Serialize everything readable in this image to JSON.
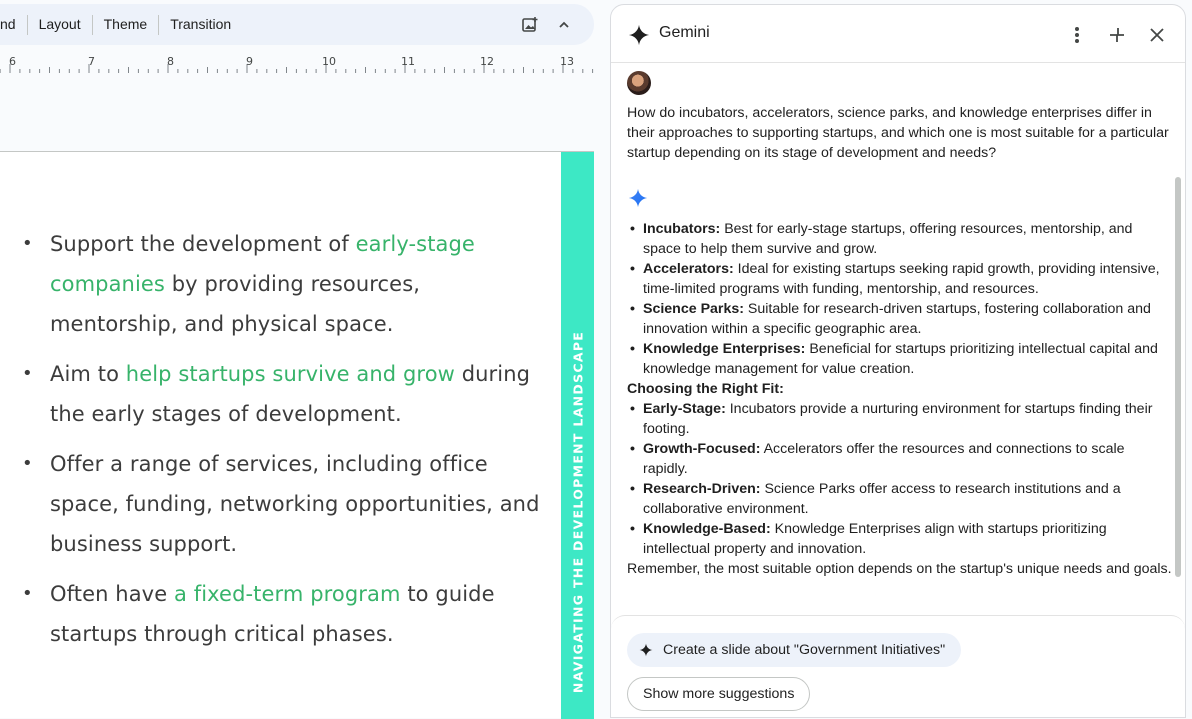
{
  "toolbar": {
    "items": [
      "nd",
      "Layout",
      "Theme",
      "Transition"
    ],
    "icons": [
      "insert-image-icon",
      "chevron-up-icon"
    ]
  },
  "ruler": {
    "labels": [
      "6",
      "7",
      "8",
      "9",
      "10",
      "11",
      "12",
      "13"
    ]
  },
  "slide": {
    "side_title": "NAVIGATING THE DEVELOPMENT LANDSCAPE",
    "accent_color": "#3de8c5",
    "highlight_color": "#37b36a",
    "bullets": [
      {
        "pre": "Support the development of ",
        "hl": "early-stage companies",
        "post": " by providing resources, mentorship, and physical space."
      },
      {
        "pre": "Aim to ",
        "hl": "help startups survive and grow",
        "post": " during the early stages of development."
      },
      {
        "pre": "Offer a range of services, including office space, funding, networking opportunities, and business support.",
        "hl": "",
        "post": ""
      },
      {
        "pre": "Often have ",
        "hl": "a fixed-term program",
        "post": " to guide startups through critical phases."
      }
    ]
  },
  "gemini": {
    "title": "Gemini",
    "question": "How do incubators, accelerators, science parks, and knowledge enterprises differ in their approaches to supporting startups, and which one is most suitable for a particular startup depending on its stage of development and needs?",
    "list1": [
      {
        "term": "Incubators:",
        "text": " Best for early-stage startups, offering resources, mentorship, and space to help them survive and grow."
      },
      {
        "term": "Accelerators:",
        "text": " Ideal for existing startups seeking rapid growth, providing intensive, time-limited programs with funding, mentorship, and resources."
      },
      {
        "term": "Science Parks:",
        "text": " Suitable for research-driven startups, fostering collaboration and innovation within a specific geographic area."
      },
      {
        "term": "Knowledge Enterprises:",
        "text": " Beneficial for startups prioritizing intellectual capital and knowledge management for value creation."
      }
    ],
    "heading2": "Choosing the Right Fit:",
    "list2": [
      {
        "term": "Early-Stage:",
        "text": " Incubators provide a nurturing environment for startups finding their footing."
      },
      {
        "term": "Growth-Focused:",
        "text": " Accelerators offer the resources and connections to scale rapidly."
      },
      {
        "term": "Research-Driven:",
        "text": " Science Parks offer access to research institutions and a collaborative environment."
      },
      {
        "term": "Knowledge-Based:",
        "text": " Knowledge Enterprises align with startups prioritizing intellectual property and innovation."
      }
    ],
    "closing": "Remember, the most suitable option depends on the startup's unique needs and goals.",
    "suggestion_primary": "Create a slide about \"Government Initiatives\"",
    "suggestion_more": "Show more suggestions"
  }
}
